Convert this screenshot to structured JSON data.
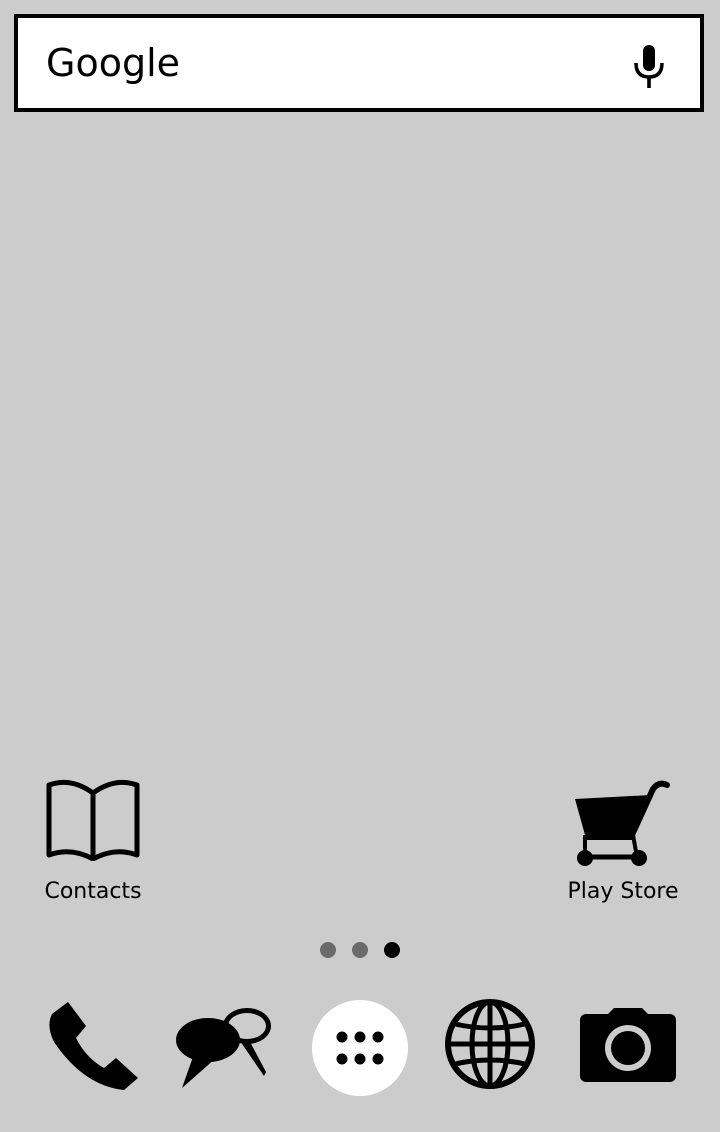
{
  "search": {
    "text": "Google",
    "mic_icon": "microphone-icon"
  },
  "shortcuts": [
    {
      "label": "Contacts",
      "icon": "book-icon"
    },
    {
      "label": "Play Store",
      "icon": "shopping-cart-icon"
    }
  ],
  "page_indicator": {
    "pages": 3,
    "active_page": 3,
    "active_color": "#000000",
    "inactive_color": "#6b6b6b"
  },
  "dock": [
    {
      "icon": "phone-icon"
    },
    {
      "icon": "messaging-icon"
    },
    {
      "icon": "app-drawer-icon"
    },
    {
      "icon": "globe-icon"
    },
    {
      "icon": "camera-icon"
    }
  ],
  "colors": {
    "wallpaper": "#cccccc",
    "icon": "#000000",
    "search_background": "#ffffff"
  }
}
